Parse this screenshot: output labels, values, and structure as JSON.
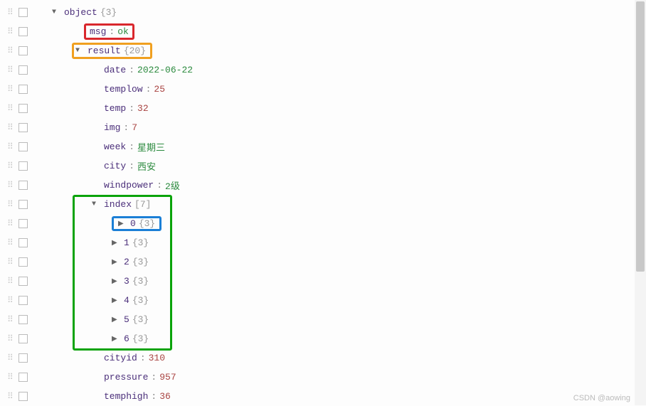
{
  "root": {
    "key": "object",
    "meta": "{3}"
  },
  "msg": {
    "key": "msg",
    "value": "ok"
  },
  "result": {
    "key": "result",
    "meta": "{20}"
  },
  "fields": {
    "date": {
      "key": "date",
      "value": "2022-06-22",
      "type": "str"
    },
    "templow": {
      "key": "templow",
      "value": "25",
      "type": "num"
    },
    "temp": {
      "key": "temp",
      "value": "32",
      "type": "num"
    },
    "img": {
      "key": "img",
      "value": "7",
      "type": "num"
    },
    "week": {
      "key": "week",
      "value": "星期三",
      "type": "str"
    },
    "city": {
      "key": "city",
      "value": "西安",
      "type": "str"
    },
    "windpower": {
      "key": "windpower",
      "value": "2级",
      "type": "str"
    },
    "cityid": {
      "key": "cityid",
      "value": "310",
      "type": "num"
    },
    "pressure": {
      "key": "pressure",
      "value": "957",
      "type": "num"
    },
    "temphigh": {
      "key": "temphigh",
      "value": "36",
      "type": "num"
    }
  },
  "index": {
    "key": "index",
    "meta": "[7]",
    "items": [
      {
        "key": "0",
        "meta": "{3}"
      },
      {
        "key": "1",
        "meta": "{3}"
      },
      {
        "key": "2",
        "meta": "{3}"
      },
      {
        "key": "3",
        "meta": "{3}"
      },
      {
        "key": "4",
        "meta": "{3}"
      },
      {
        "key": "5",
        "meta": "{3}"
      },
      {
        "key": "6",
        "meta": "{3}"
      }
    ]
  },
  "watermark": "CSDN @aowing"
}
